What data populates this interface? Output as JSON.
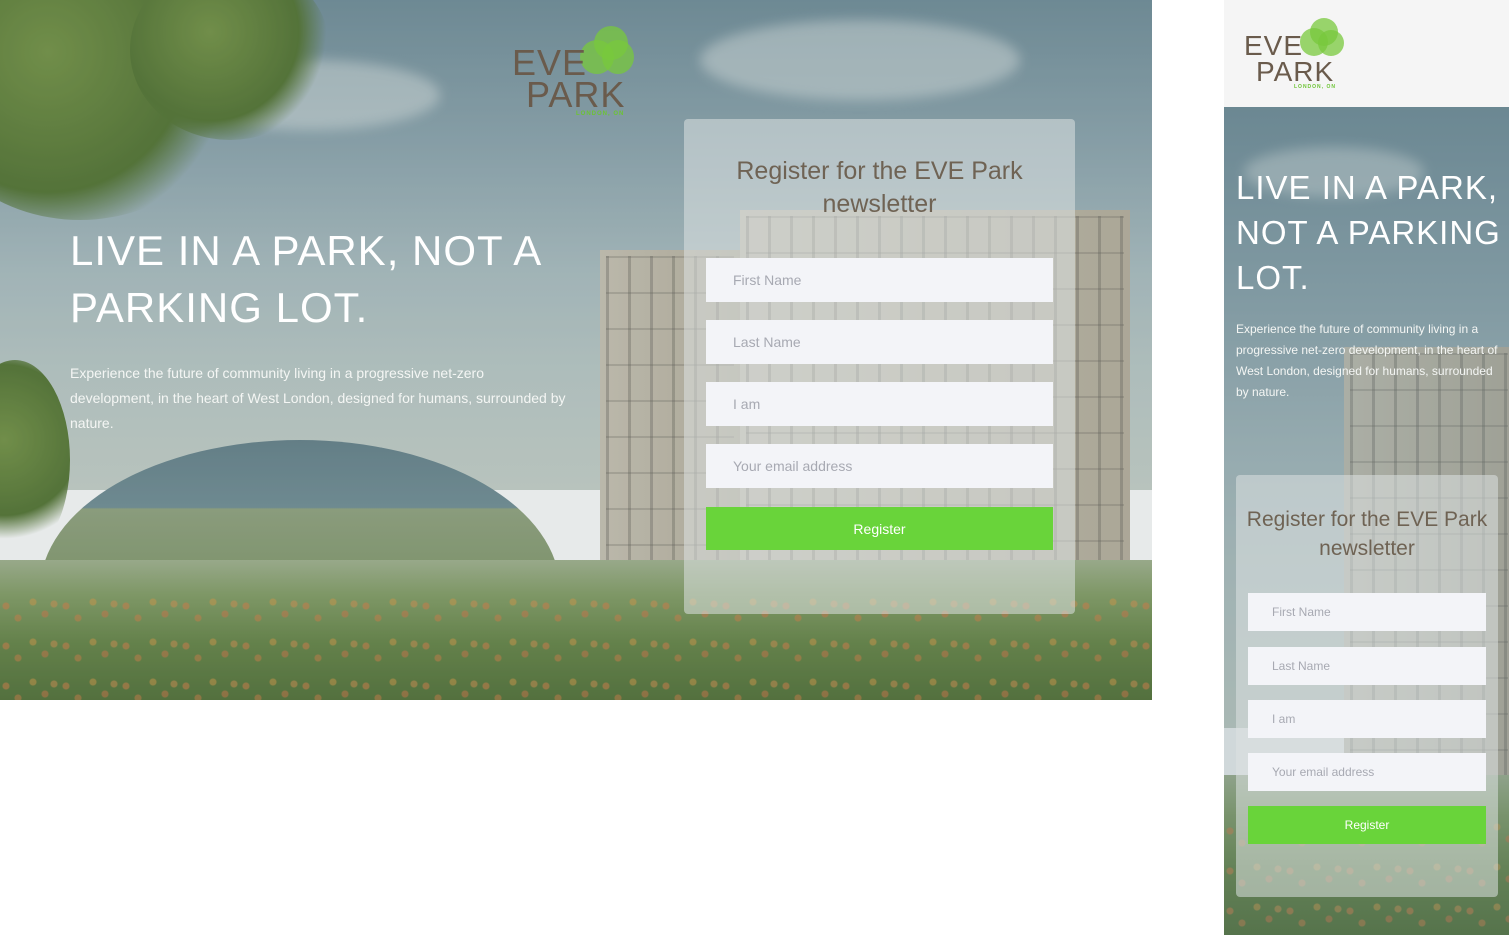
{
  "brand": {
    "name_line1": "EVE",
    "name_line2": "PARK",
    "location": "LONDON, ON",
    "colors": {
      "green": "#69d43a",
      "brown": "#6a5b4c",
      "field_bg": "#f3f4f8"
    }
  },
  "hero": {
    "title": "LIVE IN A PARK, NOT A PARKING LOT.",
    "description": "Experience the future of community living in a progressive net-zero development, in the heart of West London, designed for humans, surrounded by nature."
  },
  "form": {
    "title": "Register for the EVE Park newsletter",
    "first_name_placeholder": "First Name",
    "last_name_placeholder": "Last Name",
    "i_am_placeholder": "I am",
    "email_placeholder": "Your email address",
    "submit_label": "Register"
  }
}
